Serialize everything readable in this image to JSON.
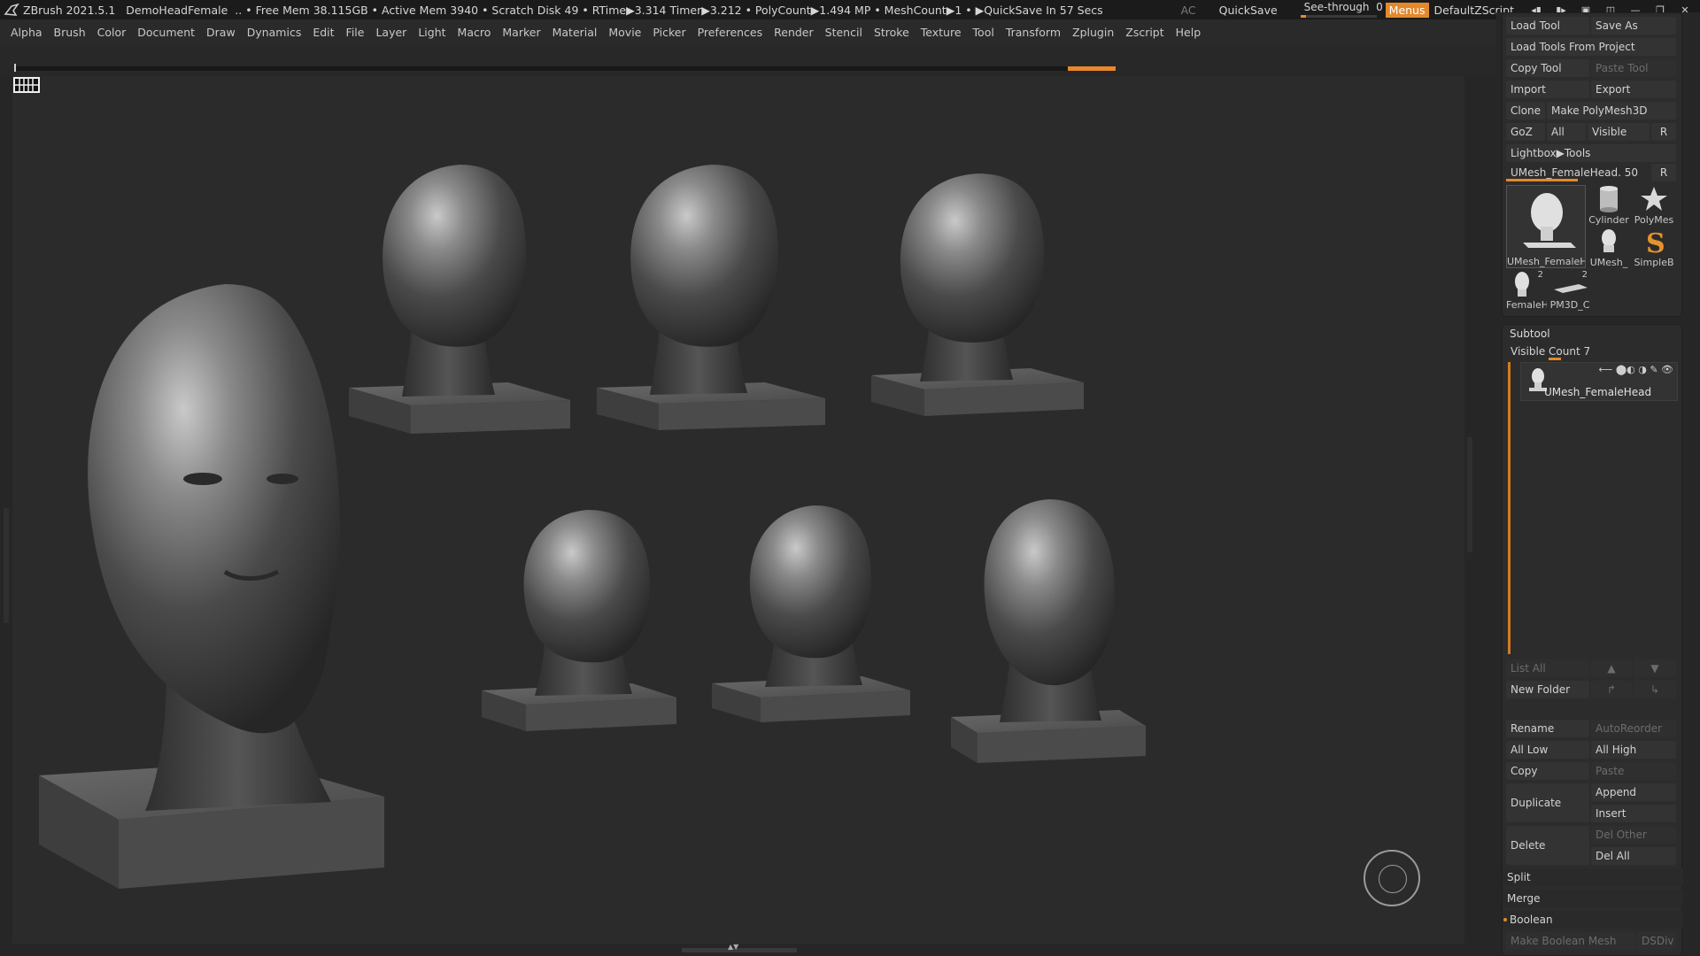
{
  "titlebar": {
    "app": "ZBrush 2021.5.1",
    "project": "DemoHeadFemale",
    "stats": ".. • Free Mem 38.115GB • Active Mem 3940 • Scratch Disk 49 • RTime▶3.314 Timer▶3.212 • PolyCount▶1.494 MP • MeshCount▶1 • ▶QuickSave In 57 Secs",
    "ac": "AC",
    "quicksave": "QuickSave",
    "see_through_label": "See-through",
    "see_through_value": "0",
    "see_through_level": 0.0,
    "menus": "Menus",
    "script": "DefaultZScript"
  },
  "menubar": [
    "Alpha",
    "Brush",
    "Color",
    "Document",
    "Draw",
    "Dynamics",
    "Edit",
    "File",
    "Layer",
    "Light",
    "Macro",
    "Marker",
    "Material",
    "Movie",
    "Picker",
    "Preferences",
    "Render",
    "Stencil",
    "Stroke",
    "Texture",
    "Tool",
    "Transform",
    "Zplugin",
    "Zscript",
    "Help"
  ],
  "tool_panel": {
    "load_tool": "Load Tool",
    "save_as": "Save As",
    "load_from_project": "Load Tools From Project",
    "copy_tool": "Copy Tool",
    "paste_tool": "Paste Tool",
    "import": "Import",
    "export": "Export",
    "clone": "Clone",
    "make_polymesh": "Make PolyMesh3D",
    "goz": "GoZ",
    "all": "All",
    "visible": "Visible",
    "r": "R",
    "lightbox_tools": "Lightbox▶Tools",
    "current_tool_slider": "UMesh_FemaleHead. 50",
    "current_tool_level": 0.5,
    "thumbs": [
      {
        "name": "UMesh_FemaleH",
        "icon": "head-icon"
      },
      {
        "name": "Cylinder",
        "icon": "cylinder-icon"
      },
      {
        "name": "PolyMes",
        "icon": "star-icon"
      },
      {
        "name": "UMesh_",
        "icon": "head-icon"
      },
      {
        "name": "SimpleB",
        "icon": "brush-s-icon"
      },
      {
        "name": "FemaleH",
        "icon": "head-icon",
        "badge": "2"
      },
      {
        "name": "PM3D_C",
        "icon": "plane-icon",
        "badge": "2"
      }
    ]
  },
  "subtool": {
    "title": "Subtool",
    "visible_count": "Visible Count 7",
    "item_name": "UMesh_FemaleHead",
    "list_all": "List All",
    "new_folder": "New Folder",
    "rename": "Rename",
    "auto_reorder": "AutoReorder",
    "all_low": "All Low",
    "all_high": "All High",
    "copy": "Copy",
    "paste": "Paste",
    "duplicate": "Duplicate",
    "append": "Append",
    "insert": "Insert",
    "delete": "Delete",
    "del_other": "Del Other",
    "del_all": "Del All",
    "split": "Split",
    "merge": "Merge",
    "boolean": "Boolean",
    "make_boolean_mesh": "Make Boolean Mesh",
    "dsdiv": "DSDiv"
  },
  "colors": {
    "accent": "#e3892b",
    "panel": "#262626",
    "canvas": "#2b2b2b"
  }
}
